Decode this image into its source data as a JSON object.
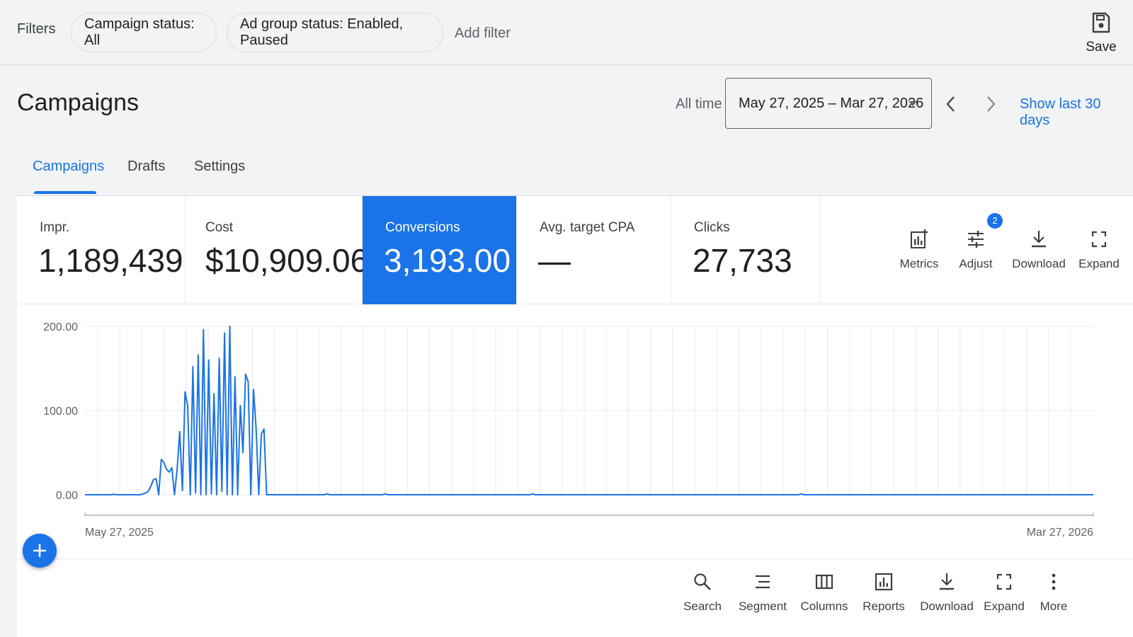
{
  "filters": {
    "label": "Filters",
    "chips": [
      "Campaign status: All",
      "Ad group status: Enabled, Paused"
    ],
    "add_filter": "Add filter",
    "save_label": "Save"
  },
  "header": {
    "title": "Campaigns",
    "range_label": "All time",
    "date_range": "May 27, 2025 – Mar 27, 2026",
    "show_last": "Show last 30 days"
  },
  "tabs": [
    {
      "label": "Campaigns",
      "active": true
    },
    {
      "label": "Drafts",
      "active": false
    },
    {
      "label": "Settings",
      "active": false
    }
  ],
  "metrics": [
    {
      "label": "Impr.",
      "value": "1,189,439"
    },
    {
      "label": "Cost",
      "value": "$10,909.06"
    },
    {
      "label": "Conversions",
      "value": "3,193.00",
      "selected": true
    },
    {
      "label": "Avg. target CPA",
      "value": "—"
    },
    {
      "label": "Clicks",
      "value": "27,733"
    }
  ],
  "metric_tools": [
    {
      "label": "Metrics",
      "icon": "metrics-icon"
    },
    {
      "label": "Adjust",
      "icon": "adjust-icon",
      "badge": "2"
    },
    {
      "label": "Download",
      "icon": "download-icon"
    },
    {
      "label": "Expand",
      "icon": "expand-icon"
    }
  ],
  "bottom_tools": [
    {
      "label": "Search",
      "icon": "search-icon"
    },
    {
      "label": "Segment",
      "icon": "segment-icon"
    },
    {
      "label": "Columns",
      "icon": "columns-icon"
    },
    {
      "label": "Reports",
      "icon": "reports-icon"
    },
    {
      "label": "Download",
      "icon": "download-icon"
    },
    {
      "label": "Expand",
      "icon": "expand-icon"
    },
    {
      "label": "More",
      "icon": "more-vert-icon"
    }
  ],
  "colors": {
    "accent": "#1a73e8",
    "line": "#1a73e8",
    "grid": "#e8eaed"
  },
  "chart_data": {
    "type": "line",
    "series": [
      {
        "values": [
          0,
          0,
          0,
          0,
          0,
          0,
          0,
          0,
          0,
          0,
          0,
          0.5,
          0,
          0,
          0,
          0,
          0,
          0,
          0,
          0,
          0,
          0,
          1,
          2,
          4,
          10,
          18,
          19,
          0,
          42,
          38,
          30,
          27,
          32,
          0,
          30,
          75,
          5,
          122,
          106,
          0,
          152,
          2,
          166,
          0,
          196,
          0,
          160,
          1,
          120,
          0,
          162,
          4,
          192,
          0,
          200,
          0,
          140,
          0,
          106,
          50,
          143,
          134,
          0,
          125,
          78,
          0,
          72,
          78,
          0,
          0,
          0,
          0,
          0,
          0,
          0,
          0,
          0,
          0,
          0,
          0,
          0,
          0,
          0,
          0,
          0,
          0,
          0,
          0,
          0,
          0,
          0,
          1,
          0,
          0,
          0,
          0,
          0,
          0,
          0,
          0,
          0,
          0,
          0,
          0,
          0,
          0,
          0,
          0,
          0,
          0,
          0,
          0,
          0,
          1,
          0,
          0,
          0,
          0,
          0,
          0,
          0,
          0,
          0,
          0,
          0,
          0,
          0,
          0,
          0,
          0,
          0,
          0,
          0,
          0,
          0,
          0,
          0,
          0,
          0,
          0,
          0,
          0,
          0,
          0,
          0,
          0,
          0,
          0,
          0,
          0,
          0,
          0,
          0,
          0,
          0,
          0,
          0,
          0,
          0,
          0,
          0,
          0,
          0,
          0,
          0,
          0,
          0,
          0,
          0,
          1,
          0,
          0,
          0,
          0,
          0,
          0,
          0,
          0,
          0,
          0,
          0,
          0,
          0,
          0,
          0,
          0,
          0,
          0,
          0,
          0,
          0,
          0,
          0,
          0,
          0,
          0,
          0,
          0,
          0,
          0,
          0,
          0,
          0,
          0,
          0,
          0,
          0,
          0,
          0,
          0,
          0,
          0,
          0,
          0,
          0,
          0,
          0,
          0,
          0,
          0,
          0,
          0,
          0,
          0,
          0,
          0,
          0,
          0,
          0,
          0,
          0,
          0,
          0,
          0,
          0,
          0,
          0,
          0,
          0,
          0,
          0,
          0,
          0,
          0,
          0,
          0,
          0,
          0,
          0,
          0,
          0,
          0,
          0,
          0,
          0,
          0,
          0,
          0,
          0,
          0,
          0,
          0,
          0,
          0,
          0,
          0,
          0,
          0,
          0,
          0,
          0,
          1,
          0,
          0,
          0,
          0,
          0,
          0,
          0,
          0,
          0,
          0,
          0,
          0,
          0,
          0,
          0,
          0,
          0,
          0,
          0,
          0,
          0,
          0,
          0,
          0,
          0,
          0,
          0,
          0,
          0,
          0,
          0,
          0,
          0,
          0,
          0,
          0,
          0,
          0,
          0,
          0,
          0,
          0,
          0,
          0,
          0,
          0,
          0,
          0,
          0,
          0,
          0,
          0,
          0,
          0,
          0,
          0,
          0,
          0,
          0,
          0,
          0,
          0,
          0,
          0,
          0,
          0,
          0,
          0,
          0,
          0,
          0,
          0,
          0,
          0,
          0,
          0,
          0,
          0,
          0,
          0,
          0,
          0,
          0,
          0,
          0,
          0,
          0,
          0,
          0,
          0,
          0,
          0,
          0,
          0,
          0,
          0,
          0,
          0,
          0,
          0,
          0,
          0,
          0,
          0,
          0,
          0,
          0,
          0,
          0,
          0,
          0
        ]
      }
    ],
    "y_ticks": [
      "200.00",
      "100.00",
      "0.00"
    ],
    "ylim": [
      0,
      200
    ],
    "x_labels": [
      "May 27, 2025",
      "Mar 27, 2026"
    ],
    "grid": true
  }
}
